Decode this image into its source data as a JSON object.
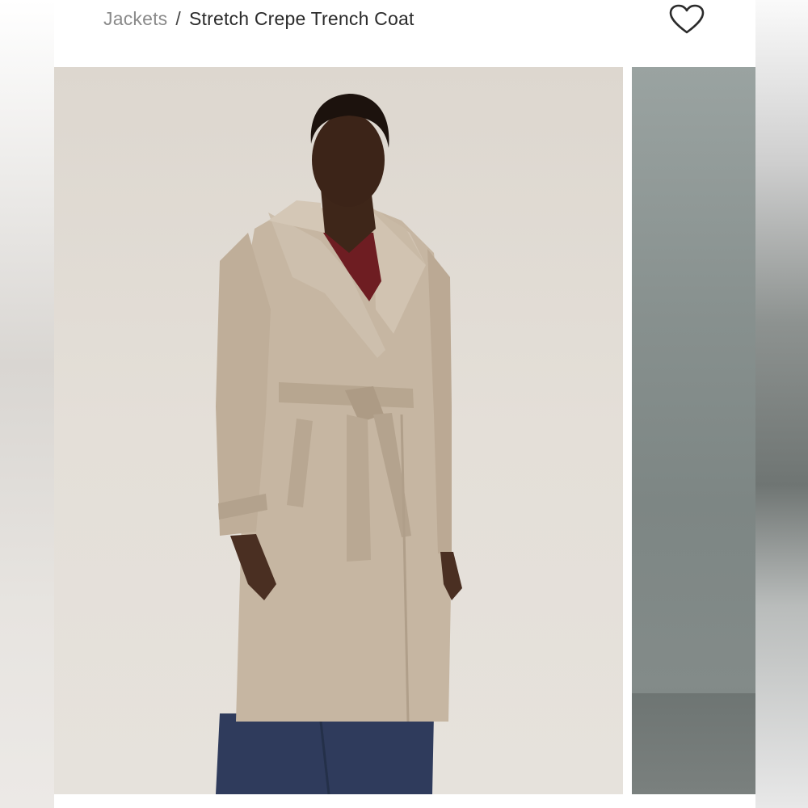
{
  "breadcrumb": {
    "parent": "Jackets",
    "separator": "/",
    "current": "Stretch Crepe Trench Coat"
  },
  "icons": {
    "favorite": "heart-outline-icon"
  },
  "gallery": {
    "main_photo": "product-photo-model-in-trench-coat",
    "next_photo": "product-photo-next-preview"
  },
  "colors": {
    "text_primary": "#2b2b2b",
    "text_muted": "#8a8a8a",
    "coat": "#c6b6a2",
    "backdrop": "#e2ddd6"
  }
}
